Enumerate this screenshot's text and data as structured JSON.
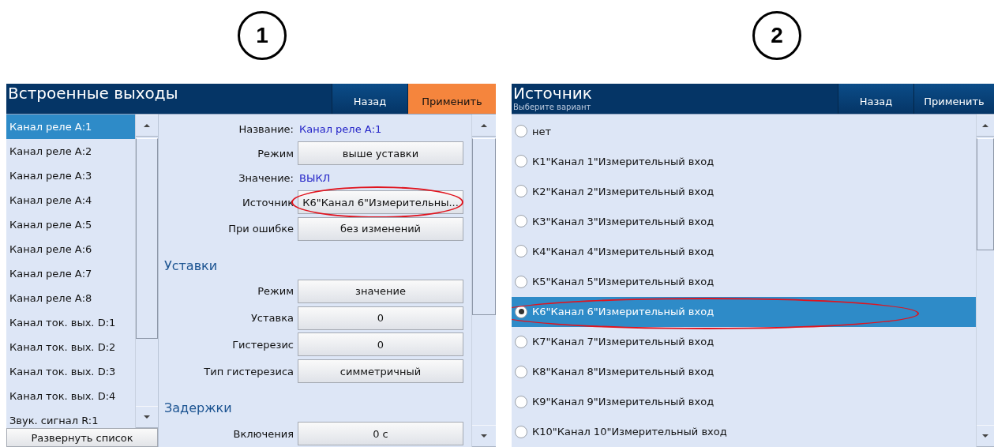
{
  "panels": [
    {
      "number": "1",
      "kind": "settings",
      "title": "Встроенные выходы",
      "buttons": [
        {
          "label": "Назад",
          "highlighted": false
        },
        {
          "label": "Применить",
          "highlighted": true
        }
      ],
      "list": [
        {
          "label": "Канал реле А:1",
          "selected": true
        },
        {
          "label": "Канал реле А:2",
          "selected": false
        },
        {
          "label": "Канал реле А:3",
          "selected": false
        },
        {
          "label": "Канал реле А:4",
          "selected": false
        },
        {
          "label": "Канал реле А:5",
          "selected": false
        },
        {
          "label": "Канал реле А:6",
          "selected": false
        },
        {
          "label": "Канал реле А:7",
          "selected": false
        },
        {
          "label": "Канал реле А:8",
          "selected": false
        },
        {
          "label": "Канал ток. вых. D:1",
          "selected": false
        },
        {
          "label": "Канал ток. вых. D:2",
          "selected": false
        },
        {
          "label": "Канал ток. вых. D:3",
          "selected": false
        },
        {
          "label": "Канал ток. вых. D:4",
          "selected": false
        },
        {
          "label": "Звук. сигнал R:1",
          "selected": false
        }
      ],
      "expand_button": "Развернуть список",
      "form": [
        {
          "kind": "text",
          "label": "Название:",
          "value": "Канал реле А:1"
        },
        {
          "kind": "select",
          "label": "Режим",
          "value": "выше уставки",
          "circled": false
        },
        {
          "kind": "text",
          "label": "Значение:",
          "value": "ВЫКЛ"
        },
        {
          "kind": "select",
          "label": "Источник",
          "value": "К6\"Канал 6\"Измерительны...",
          "circled": true
        },
        {
          "kind": "select",
          "label": "При ошибке",
          "value": "без изменений",
          "circled": false
        },
        {
          "kind": "heading",
          "label": "Уставки"
        },
        {
          "kind": "select",
          "label": "Режим",
          "value": "значение",
          "circled": false
        },
        {
          "kind": "select",
          "label": "Уставка",
          "value": "0",
          "circled": false
        },
        {
          "kind": "select",
          "label": "Гистерезис",
          "value": "0",
          "circled": false
        },
        {
          "kind": "select",
          "label": "Тип гистерезиса",
          "value": "симметричный",
          "circled": false
        },
        {
          "kind": "heading",
          "label": "Задержки"
        },
        {
          "kind": "select",
          "label": "Включения",
          "value": "0 с",
          "circled": false
        }
      ]
    },
    {
      "number": "2",
      "kind": "picker",
      "title": "Источник",
      "subtitle": "Выберите вариант",
      "buttons": [
        {
          "label": "Назад",
          "highlighted": false
        },
        {
          "label": "Применить",
          "highlighted": false
        }
      ],
      "options": [
        {
          "label": "нет",
          "selected": false,
          "circled": false
        },
        {
          "label": "К1\"Канал 1\"Измерительный вход",
          "selected": false,
          "circled": false
        },
        {
          "label": "К2\"Канал 2\"Измерительный вход",
          "selected": false,
          "circled": false
        },
        {
          "label": "К3\"Канал 3\"Измерительный вход",
          "selected": false,
          "circled": false
        },
        {
          "label": "К4\"Канал 4\"Измерительный вход",
          "selected": false,
          "circled": false
        },
        {
          "label": "К5\"Канал 5\"Измерительный вход",
          "selected": false,
          "circled": false
        },
        {
          "label": "К6\"Канал 6\"Измерительный вход",
          "selected": true,
          "circled": true
        },
        {
          "label": "К7\"Канал 7\"Измерительный вход",
          "selected": false,
          "circled": false
        },
        {
          "label": "К8\"Канал 8\"Измерительный вход",
          "selected": false,
          "circled": false
        },
        {
          "label": "К9\"Канал 9\"Измерительный вход",
          "selected": false,
          "circled": false
        },
        {
          "label": "К10\"Канал 10\"Измерительный вход",
          "selected": false,
          "circled": false
        }
      ]
    }
  ]
}
